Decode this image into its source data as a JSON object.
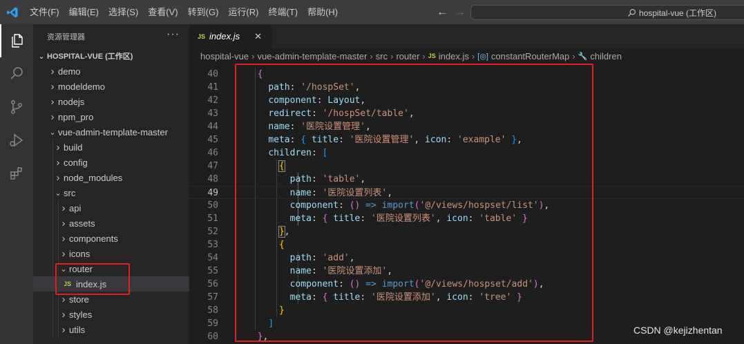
{
  "titlebar": {
    "menu": [
      "文件(F)",
      "编辑(E)",
      "选择(S)",
      "查看(V)",
      "转到(G)",
      "运行(R)",
      "终端(T)",
      "帮助(H)"
    ],
    "search_text": "hospital-vue (工作区)",
    "back_glyph": "←",
    "forward_glyph": "→"
  },
  "sidebar": {
    "title": "资源管理器",
    "more_glyph": "···",
    "workspace": "HOSPITAL-VUE (工作区)",
    "tree": [
      {
        "label": "demo",
        "level": 1,
        "expanded": false
      },
      {
        "label": "modeldemo",
        "level": 1,
        "expanded": false
      },
      {
        "label": "nodejs",
        "level": 1,
        "expanded": false
      },
      {
        "label": "npm_pro",
        "level": 1,
        "expanded": false
      },
      {
        "label": "vue-admin-template-master",
        "level": 1,
        "expanded": true
      },
      {
        "label": "build",
        "level": 2,
        "expanded": false
      },
      {
        "label": "config",
        "level": 2,
        "expanded": false
      },
      {
        "label": "node_modules",
        "level": 2,
        "expanded": false
      },
      {
        "label": "src",
        "level": 2,
        "expanded": true
      },
      {
        "label": "api",
        "level": 3,
        "expanded": false
      },
      {
        "label": "assets",
        "level": 3,
        "expanded": false
      },
      {
        "label": "components",
        "level": 3,
        "expanded": false
      },
      {
        "label": "icons",
        "level": 3,
        "expanded": false
      },
      {
        "label": "router",
        "level": 3,
        "expanded": true
      },
      {
        "label": "index.js",
        "level": 4,
        "file": "JS",
        "selected": true
      },
      {
        "label": "store",
        "level": 3,
        "expanded": false
      },
      {
        "label": "styles",
        "level": 3,
        "expanded": false
      },
      {
        "label": "utils",
        "level": 3,
        "expanded": false
      }
    ]
  },
  "editor": {
    "tab": {
      "badge": "JS",
      "name": "index.js",
      "close": "✕"
    },
    "breadcrumb": {
      "items": [
        "hospital-vue",
        "vue-admin-template-master",
        "src",
        "router",
        "index.js",
        "constantRouterMap",
        "children"
      ],
      "sep": "›",
      "js_badge": "JS"
    },
    "line_numbers": [
      "40",
      "41",
      "42",
      "43",
      "44",
      "45",
      "46",
      "47",
      "48",
      "49",
      "50",
      "51",
      "52",
      "53",
      "54",
      "55",
      "56",
      "57",
      "58",
      "59",
      "60"
    ],
    "active_line": "49",
    "code": [
      [
        {
          "t": "  "
        },
        {
          "t": "{",
          "c": "b1"
        }
      ],
      [
        {
          "t": "    "
        },
        {
          "t": "path",
          "c": "prop"
        },
        {
          "t": ": "
        },
        {
          "t": "'/hospSet'",
          "c": "str"
        },
        {
          "t": ","
        }
      ],
      [
        {
          "t": "    "
        },
        {
          "t": "component",
          "c": "prop"
        },
        {
          "t": ": "
        },
        {
          "t": "Layout",
          "c": "ident"
        },
        {
          "t": ","
        }
      ],
      [
        {
          "t": "    "
        },
        {
          "t": "redirect",
          "c": "prop"
        },
        {
          "t": ": "
        },
        {
          "t": "'/hospSet/table'",
          "c": "str"
        },
        {
          "t": ","
        }
      ],
      [
        {
          "t": "    "
        },
        {
          "t": "name",
          "c": "prop"
        },
        {
          "t": ": "
        },
        {
          "t": "'医院设置管理'",
          "c": "str"
        },
        {
          "t": ","
        }
      ],
      [
        {
          "t": "    "
        },
        {
          "t": "meta",
          "c": "prop"
        },
        {
          "t": ": "
        },
        {
          "t": "{",
          "c": "b2"
        },
        {
          "t": " "
        },
        {
          "t": "title",
          "c": "prop"
        },
        {
          "t": ": "
        },
        {
          "t": "'医院设置管理'",
          "c": "str"
        },
        {
          "t": ", "
        },
        {
          "t": "icon",
          "c": "prop"
        },
        {
          "t": ": "
        },
        {
          "t": "'example'",
          "c": "str"
        },
        {
          "t": " "
        },
        {
          "t": "}",
          "c": "b2"
        },
        {
          "t": ","
        }
      ],
      [
        {
          "t": "    "
        },
        {
          "t": "children",
          "c": "prop"
        },
        {
          "t": ": "
        },
        {
          "t": "[",
          "c": "b2"
        }
      ],
      [
        {
          "t": "      "
        },
        {
          "t": "{",
          "c": "b3 bm"
        }
      ],
      [
        {
          "t": "        "
        },
        {
          "t": "path",
          "c": "prop"
        },
        {
          "t": ": "
        },
        {
          "t": "'table'",
          "c": "str"
        },
        {
          "t": ","
        }
      ],
      [
        {
          "t": "        "
        },
        {
          "t": "name",
          "c": "prop"
        },
        {
          "t": ": "
        },
        {
          "t": "'医院设置列表'",
          "c": "str"
        },
        {
          "t": ","
        }
      ],
      [
        {
          "t": "        "
        },
        {
          "t": "component",
          "c": "prop"
        },
        {
          "t": ": "
        },
        {
          "t": "()",
          "c": "b1"
        },
        {
          "t": " "
        },
        {
          "t": "=>",
          "c": "kw"
        },
        {
          "t": " "
        },
        {
          "t": "import",
          "c": "kw"
        },
        {
          "t": "(",
          "c": "b1"
        },
        {
          "t": "'@/views/hospset/list'",
          "c": "str"
        },
        {
          "t": ")",
          "c": "b1"
        },
        {
          "t": ","
        }
      ],
      [
        {
          "t": "        "
        },
        {
          "t": "meta",
          "c": "prop"
        },
        {
          "t": ": "
        },
        {
          "t": "{",
          "c": "b1"
        },
        {
          "t": " "
        },
        {
          "t": "title",
          "c": "prop"
        },
        {
          "t": ": "
        },
        {
          "t": "'医院设置列表'",
          "c": "str"
        },
        {
          "t": ", "
        },
        {
          "t": "icon",
          "c": "prop"
        },
        {
          "t": ": "
        },
        {
          "t": "'table'",
          "c": "str"
        },
        {
          "t": " "
        },
        {
          "t": "}",
          "c": "b1"
        }
      ],
      [
        {
          "t": "      "
        },
        {
          "t": "}",
          "c": "b3 bm"
        },
        {
          "t": ","
        }
      ],
      [
        {
          "t": "      "
        },
        {
          "t": "{",
          "c": "b3"
        }
      ],
      [
        {
          "t": "        "
        },
        {
          "t": "path",
          "c": "prop"
        },
        {
          "t": ": "
        },
        {
          "t": "'add'",
          "c": "str"
        },
        {
          "t": ","
        }
      ],
      [
        {
          "t": "        "
        },
        {
          "t": "name",
          "c": "prop"
        },
        {
          "t": ": "
        },
        {
          "t": "'医院设置添加'",
          "c": "str"
        },
        {
          "t": ","
        }
      ],
      [
        {
          "t": "        "
        },
        {
          "t": "component",
          "c": "prop"
        },
        {
          "t": ": "
        },
        {
          "t": "()",
          "c": "b1"
        },
        {
          "t": " "
        },
        {
          "t": "=>",
          "c": "kw"
        },
        {
          "t": " "
        },
        {
          "t": "import",
          "c": "kw"
        },
        {
          "t": "(",
          "c": "b1"
        },
        {
          "t": "'@/views/hospset/add'",
          "c": "str"
        },
        {
          "t": ")",
          "c": "b1"
        },
        {
          "t": ","
        }
      ],
      [
        {
          "t": "        "
        },
        {
          "t": "meta",
          "c": "prop"
        },
        {
          "t": ": "
        },
        {
          "t": "{",
          "c": "b1"
        },
        {
          "t": " "
        },
        {
          "t": "title",
          "c": "prop"
        },
        {
          "t": ": "
        },
        {
          "t": "'医院设置添加'",
          "c": "str"
        },
        {
          "t": ", "
        },
        {
          "t": "icon",
          "c": "prop"
        },
        {
          "t": ": "
        },
        {
          "t": "'tree'",
          "c": "str"
        },
        {
          "t": " "
        },
        {
          "t": "}",
          "c": "b1"
        }
      ],
      [
        {
          "t": "      "
        },
        {
          "t": "}",
          "c": "b3"
        }
      ],
      [
        {
          "t": "    "
        },
        {
          "t": "]",
          "c": "b2"
        }
      ],
      [
        {
          "t": "  "
        },
        {
          "t": "}",
          "c": "b1"
        },
        {
          "t": ","
        }
      ]
    ]
  },
  "watermark": "CSDN @kejizhentan",
  "colors": {
    "highlight_box": "#e02020",
    "js_badge": "#cbcb41",
    "accent": "#0e7ad3"
  }
}
